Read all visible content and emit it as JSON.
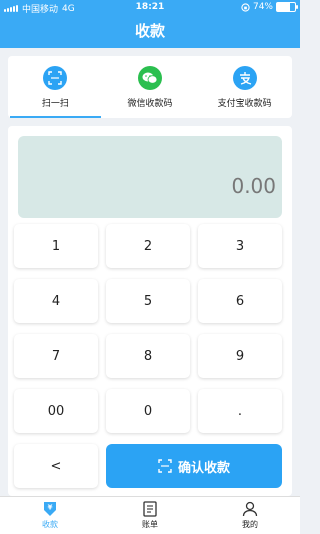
{
  "status_bar": {
    "carrier": "中国移动",
    "network": "4G",
    "time": "18:21",
    "battery_percent": "74%",
    "battery_level": 0.74
  },
  "header": {
    "title": "收款"
  },
  "payment_methods": [
    {
      "label": "扫一扫",
      "icon": "scan-icon",
      "color": "#2ba3f4",
      "active": true
    },
    {
      "label": "微信收款码",
      "icon": "wechat-icon",
      "color": "#2bbf4f",
      "active": false
    },
    {
      "label": "支付宝收款码",
      "icon": "alipay-icon",
      "color": "#2ba3f4",
      "active": false
    }
  ],
  "amount_display": {
    "value": "0.00"
  },
  "keypad": {
    "keys": [
      "1",
      "2",
      "3",
      "4",
      "5",
      "6",
      "7",
      "8",
      "9",
      "00",
      "0",
      ".",
      "<"
    ],
    "confirm_label": "确认收款"
  },
  "tab_bar": [
    {
      "label": "收款",
      "icon": "yen-icon",
      "active": true
    },
    {
      "label": "账单",
      "icon": "bill-icon",
      "active": false
    },
    {
      "label": "我的",
      "icon": "user-icon",
      "active": false
    }
  ],
  "colors": {
    "accent": "#3aaaf5",
    "display_bg": "#d7e8e6",
    "confirm_bg": "#2ba3f4"
  }
}
